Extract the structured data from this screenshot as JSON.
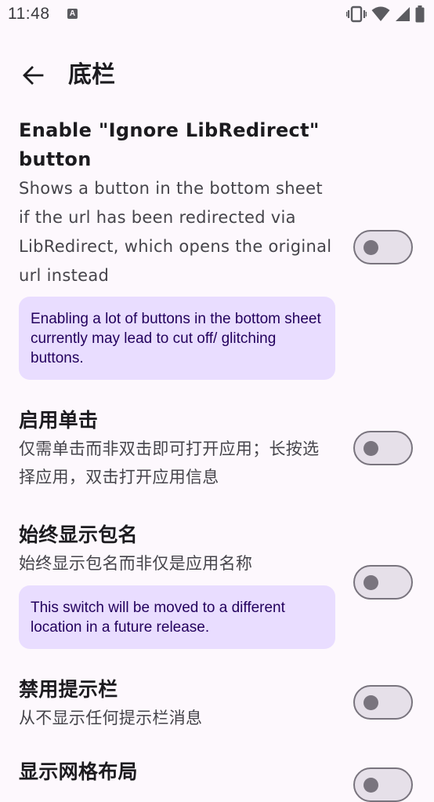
{
  "status_bar": {
    "time": "11:48",
    "notification_icon": "a-icon",
    "icons": [
      "vibrate-icon",
      "wifi-icon",
      "signal-icon",
      "battery-icon"
    ]
  },
  "app_bar": {
    "back_icon": "arrow-back-icon",
    "title": "底栏"
  },
  "settings": [
    {
      "title": "Enable \"Ignore LibRedirect\" button",
      "description": "Shows a button in the bottom sheet if the url has been redirected via LibRedirect, which opens the original url instead",
      "enabled": false,
      "note": "Enabling a lot of buttons in the bottom sheet currently may lead to cut off/ glitching buttons."
    },
    {
      "title": "启用单击",
      "description": "仅需单击而非双击即可打开应用；长按选择应用，双击打开应用信息",
      "enabled": false
    },
    {
      "title": "始终显示包名",
      "description": "始终显示包名而非仅是应用名称",
      "enabled": false,
      "note": "This switch will be moved to a different location in a future release."
    },
    {
      "title": "禁用提示栏",
      "description": "从不显示任何提示栏消息",
      "enabled": false
    },
    {
      "title": "显示网格布局",
      "enabled": false
    }
  ],
  "colors": {
    "background": "#fdf8fd",
    "note_background": "#e9ddff",
    "note_text": "#22005d",
    "switch_track": "#e6e0e9",
    "switch_outline": "#79747e"
  }
}
